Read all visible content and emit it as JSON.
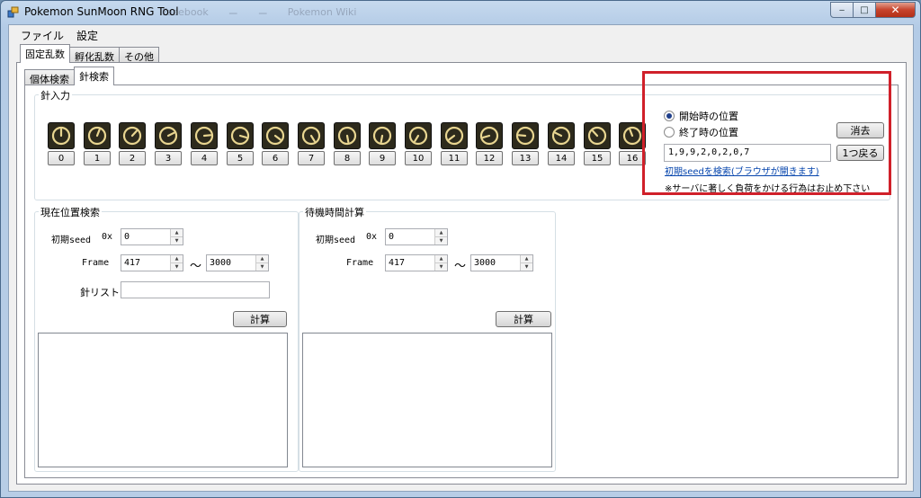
{
  "window": {
    "title": "Pokemon SunMoon RNG Tool",
    "background_tabs": [
      "Facebook",
      "ー",
      "ー",
      "Pokemon Wiki"
    ],
    "controls": {
      "minimize": "‒",
      "maximize": "□",
      "close": "✕"
    }
  },
  "menu": [
    {
      "label": "ファイル"
    },
    {
      "label": "設定"
    }
  ],
  "top_tabs": [
    {
      "label": "固定乱数",
      "active": true
    },
    {
      "label": "孵化乱数",
      "active": false
    },
    {
      "label": "その他",
      "active": false
    }
  ],
  "sub_tabs": [
    {
      "label": "個体検索",
      "active": false
    },
    {
      "label": "針検索",
      "active": true
    }
  ],
  "needle_input": {
    "group_title": "針入力",
    "buttons": [
      "0",
      "1",
      "2",
      "3",
      "4",
      "5",
      "6",
      "7",
      "8",
      "9",
      "10",
      "11",
      "12",
      "13",
      "14",
      "15",
      "16"
    ],
    "needle_directions": [
      0,
      1,
      2,
      3,
      4,
      5,
      6,
      7,
      8,
      9,
      10,
      11,
      12,
      13,
      14,
      15,
      16
    ]
  },
  "position_panel": {
    "radio_start": {
      "label": "開始時の位置",
      "checked": true
    },
    "radio_end": {
      "label": "終了時の位置",
      "checked": false
    },
    "clear_button": "消去",
    "needle_list_value": "1,9,9,2,0,2,0,7",
    "back_button": "1つ戻る",
    "search_link": "初期seedを検索(ブラウザが開きます)",
    "note": "※サーバに著しく負荷をかける行為はお止め下さい"
  },
  "current_search": {
    "title": "現在位置検索",
    "seed_label": "初期seed",
    "seed_prefix": "0x",
    "seed_value": "0",
    "frame_label": "Frame",
    "frame_min": "417",
    "range_sep": "～",
    "frame_max": "3000",
    "needle_list_label": "針リスト",
    "needle_list_value": "",
    "calc_button": "計算"
  },
  "wait_calc": {
    "title": "待機時間計算",
    "seed_label": "初期seed",
    "seed_prefix": "0x",
    "seed_value": "0",
    "frame_label": "Frame",
    "frame_min": "417",
    "range_sep": "～",
    "frame_max": "3000",
    "calc_button": "計算"
  },
  "colors": {
    "highlight_border": "#d0202a",
    "needle_bg": "#2d2a1c",
    "needle_ring": "#e8d590"
  }
}
